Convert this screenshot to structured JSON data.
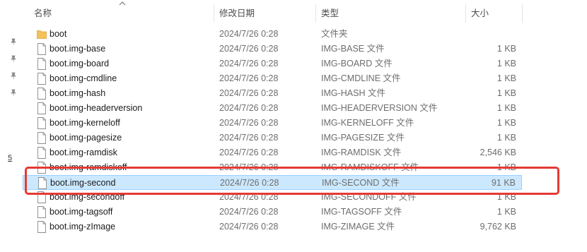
{
  "columns": {
    "name": "名称",
    "date": "修改日期",
    "type": "类型",
    "size": "大小"
  },
  "colors": {
    "selection_bg": "#cce8ff",
    "selection_border": "#99d1ff",
    "annotation": "#e53935",
    "folder": "#f4c25b"
  },
  "side_glyph": "5",
  "files": [
    {
      "name": "boot",
      "date": "2024/7/26 0:28",
      "type": "文件夹",
      "size": "",
      "icon": "folder-icon"
    },
    {
      "name": "boot.img-base",
      "date": "2024/7/26 0:28",
      "type": "IMG-BASE 文件",
      "size": "1 KB",
      "icon": "file-icon"
    },
    {
      "name": "boot.img-board",
      "date": "2024/7/26 0:28",
      "type": "IMG-BOARD 文件",
      "size": "1 KB",
      "icon": "file-icon"
    },
    {
      "name": "boot.img-cmdline",
      "date": "2024/7/26 0:28",
      "type": "IMG-CMDLINE 文件",
      "size": "1 KB",
      "icon": "file-icon"
    },
    {
      "name": "boot.img-hash",
      "date": "2024/7/26 0:28",
      "type": "IMG-HASH 文件",
      "size": "1 KB",
      "icon": "file-icon"
    },
    {
      "name": "boot.img-headerversion",
      "date": "2024/7/26 0:28",
      "type": "IMG-HEADERVERSION 文件",
      "size": "1 KB",
      "icon": "file-icon"
    },
    {
      "name": "boot.img-kerneloff",
      "date": "2024/7/26 0:28",
      "type": "IMG-KERNELOFF 文件",
      "size": "1 KB",
      "icon": "file-icon"
    },
    {
      "name": "boot.img-pagesize",
      "date": "2024/7/26 0:28",
      "type": "IMG-PAGESIZE 文件",
      "size": "1 KB",
      "icon": "file-icon"
    },
    {
      "name": "boot.img-ramdisk",
      "date": "2024/7/26 0:28",
      "type": "IMG-RAMDISK 文件",
      "size": "2,546 KB",
      "icon": "file-icon"
    },
    {
      "name": "boot.img-ramdiskoff",
      "date": "2024/7/26 0:28",
      "type": "IMG-RAMDISKOFF 文件",
      "size": "1 KB",
      "icon": "file-icon"
    },
    {
      "name": "boot.img-second",
      "date": "2024/7/26 0:28",
      "type": "IMG-SECOND 文件",
      "size": "91 KB",
      "icon": "file-icon",
      "selected": true
    },
    {
      "name": "boot.img-secondoff",
      "date": "2024/7/26 0:28",
      "type": "IMG-SECONDOFF 文件",
      "size": "1 KB",
      "icon": "file-icon"
    },
    {
      "name": "boot.img-tagsoff",
      "date": "2024/7/26 0:28",
      "type": "IMG-TAGSOFF 文件",
      "size": "1 KB",
      "icon": "file-icon"
    },
    {
      "name": "boot.img-zImage",
      "date": "2024/7/26 0:28",
      "type": "IMG-ZIMAGE 文件",
      "size": "9,762 KB",
      "icon": "file-icon"
    }
  ]
}
